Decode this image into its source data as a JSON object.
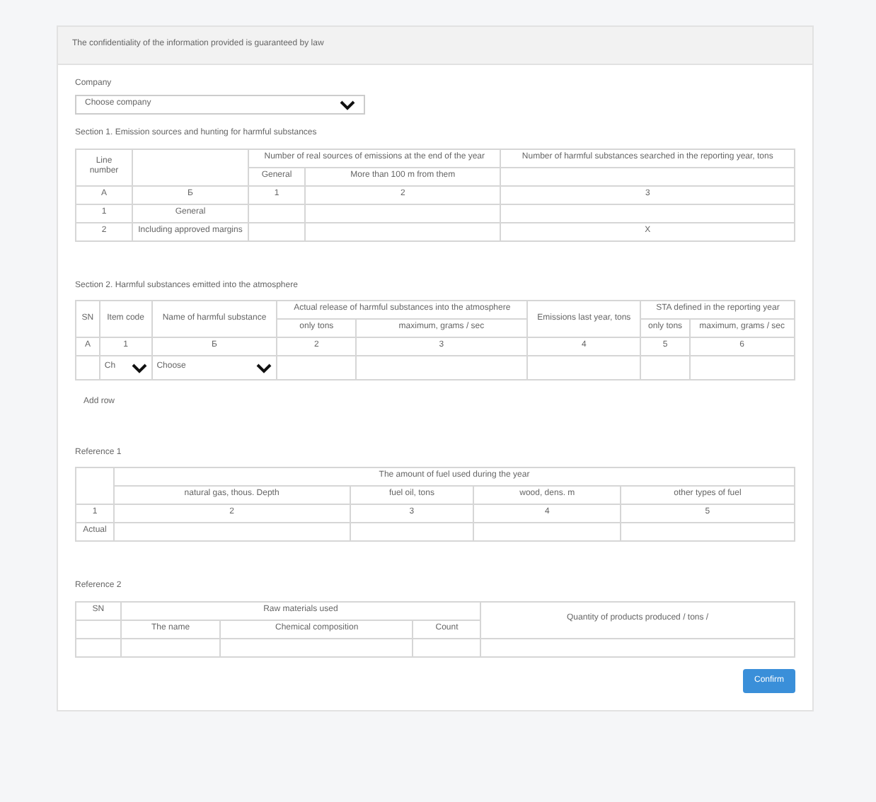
{
  "notice": "The confidentiality of the information provided is guaranteed by law",
  "company": {
    "label": "Company",
    "placeholder": "Choose company"
  },
  "sections": [
    {
      "title": "Section 1. Emission sources and hunting for harmful substances",
      "head": [
        [
          {
            "text": "Line number",
            "rowspan": 2
          },
          {
            "rowspan": 2
          },
          {
            "text": "Number of real sources of emissions at the end of the year",
            "colspan": 2
          },
          {
            "text": "Number of harmful substances searched in the reporting year, tons"
          }
        ],
        [
          {
            "text": "General"
          },
          {
            "text": "More than 100 m from them"
          },
          {
            "kind": "blank"
          }
        ]
      ],
      "rows": [
        [
          {
            "text": "A"
          },
          {
            "text": "Б"
          },
          {
            "text": "1"
          },
          {
            "text": "2"
          },
          {
            "text": "3"
          }
        ],
        [
          {
            "text": "1"
          },
          {
            "text": "General"
          },
          {},
          {},
          {}
        ],
        [
          {
            "text": "2"
          },
          {
            "text": "Including approved margins"
          },
          {},
          {},
          {
            "text": "X"
          }
        ]
      ]
    },
    {
      "title": "Section 2. Harmful substances emitted into the atmosphere",
      "add_row": "Add row",
      "head": [
        [
          {
            "text": "SN",
            "rowspan": 2
          },
          {
            "text": "Item code",
            "rowspan": 2
          },
          {
            "text": "Name of harmful substance",
            "rowspan": 2
          },
          {
            "text": "Actual release of harmful substances into the atmosphere",
            "colspan": 2
          },
          {
            "text": "Emissions last year, tons",
            "rowspan": 2
          },
          {
            "text": "STA defined in the reporting year",
            "colspan": 2
          }
        ],
        [
          {
            "text": "only tons"
          },
          {
            "text": "maximum, grams / sec"
          },
          {
            "text": "only tons"
          },
          {
            "text": "maximum, grams / sec"
          }
        ]
      ],
      "rows": [
        [
          {
            "text": "A"
          },
          {
            "text": "1"
          },
          {
            "text": "Б"
          },
          {
            "text": "2"
          },
          {
            "text": "3"
          },
          {
            "text": "4"
          },
          {
            "text": "5"
          },
          {
            "text": "6"
          }
        ],
        [
          {},
          {
            "kind": "select",
            "text": "Ch"
          },
          {
            "kind": "select",
            "text": "Choose"
          },
          {},
          {},
          {},
          {},
          {}
        ]
      ]
    },
    {
      "title": "Reference 1",
      "head": [
        [
          {
            "rowspan": 2
          },
          {
            "text": "The amount of fuel used during the year",
            "colspan": 4
          }
        ],
        [
          {
            "text": "natural gas, thous. Depth"
          },
          {
            "text": "fuel oil, tons"
          },
          {
            "text": "wood, dens. m"
          },
          {
            "text": "other types of fuel"
          }
        ]
      ],
      "rows": [
        [
          {
            "text": "1"
          },
          {
            "text": "2"
          },
          {
            "text": "3"
          },
          {
            "text": "4"
          },
          {
            "text": "5"
          }
        ],
        [
          {
            "text": "Actual"
          },
          {},
          {},
          {},
          {}
        ]
      ]
    },
    {
      "title": "Reference 2",
      "head": [
        [
          {
            "text": "SN"
          },
          {
            "text": "Raw materials used",
            "colspan": 3
          },
          {
            "text": "Quantity of products produced / tons /",
            "rowspan": 2
          }
        ],
        [
          {
            "kind": "blank"
          },
          {
            "text": "The name"
          },
          {
            "text": "Chemical composition"
          },
          {
            "text": "Count"
          }
        ]
      ],
      "rows": [
        [
          {},
          {},
          {},
          {},
          {}
        ]
      ]
    }
  ],
  "confirm": "Confirm"
}
